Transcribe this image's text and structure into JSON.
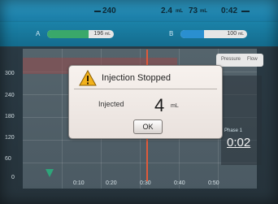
{
  "status_bar": {
    "value_1": "240",
    "value_2": "2.4",
    "unit_2": "mL",
    "value_3": "73",
    "unit_3": "mL",
    "time": "0:42"
  },
  "syringe_bars": [
    {
      "label": "A",
      "value": "196",
      "unit": "mL",
      "fill_fraction": 0.62,
      "color": "#3aa86a"
    },
    {
      "label": "B",
      "value": "100",
      "unit": "mL",
      "fill_fraction": 0.35,
      "color": "#2a8fd0"
    }
  ],
  "graph": {
    "y_ticks": [
      "300",
      "240",
      "180",
      "120",
      "60",
      "0"
    ],
    "x_ticks": [
      "0:10",
      "0:20",
      "0:30",
      "0:40",
      "0:50"
    ],
    "toggle_left": "Pressure",
    "toggle_right": "Flow",
    "timer_label": "Phase 1",
    "timer_value": "0:02"
  },
  "dialog": {
    "title": "Injection Stopped",
    "injected_label": "Injected",
    "injected_value": "4",
    "injected_unit": "mL",
    "ok_label": "OK"
  },
  "colors": {
    "header_blue": "#1a7ca5",
    "alert_red": "#e05a3a",
    "bar_green": "#3aa86a",
    "bar_blue": "#2a8fd0"
  }
}
